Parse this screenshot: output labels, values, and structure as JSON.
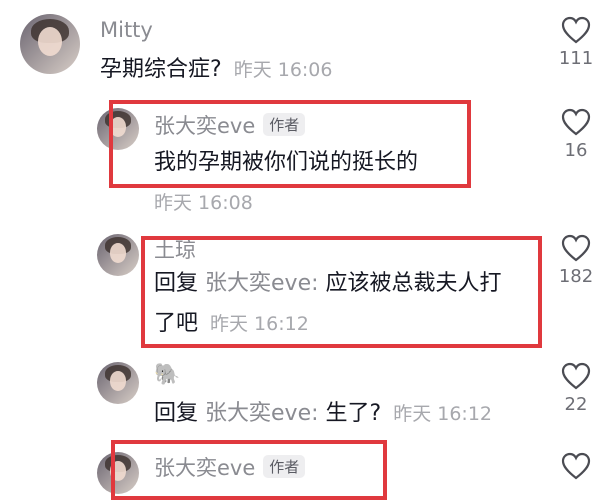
{
  "comments": [
    {
      "user": "Mitty",
      "text": "孕期综合症?",
      "time": "昨天 16:06",
      "likes": "111"
    },
    {
      "user": "张大奕eve",
      "badge": "作者",
      "text": "我的孕期被你们说的挺长的",
      "time": "昨天 16:08",
      "likes": "16"
    },
    {
      "user": "土琼",
      "reply_prefix": "回复",
      "reply_target": "张大奕eve:",
      "text_line1": "应该被总裁夫人打",
      "text_line2": "了吧",
      "time": "昨天 16:12",
      "likes": "182"
    },
    {
      "user": "🐘",
      "reply_prefix": "回复",
      "reply_target": "张大奕eve:",
      "text": "生了?",
      "time": "昨天 16:12",
      "likes": "22"
    },
    {
      "user": "张大奕eve",
      "badge": "作者"
    }
  ],
  "icons": {
    "like": "heart-outline-icon"
  },
  "colors": {
    "highlight": "#e0393e",
    "muted": "#8a8b91"
  }
}
